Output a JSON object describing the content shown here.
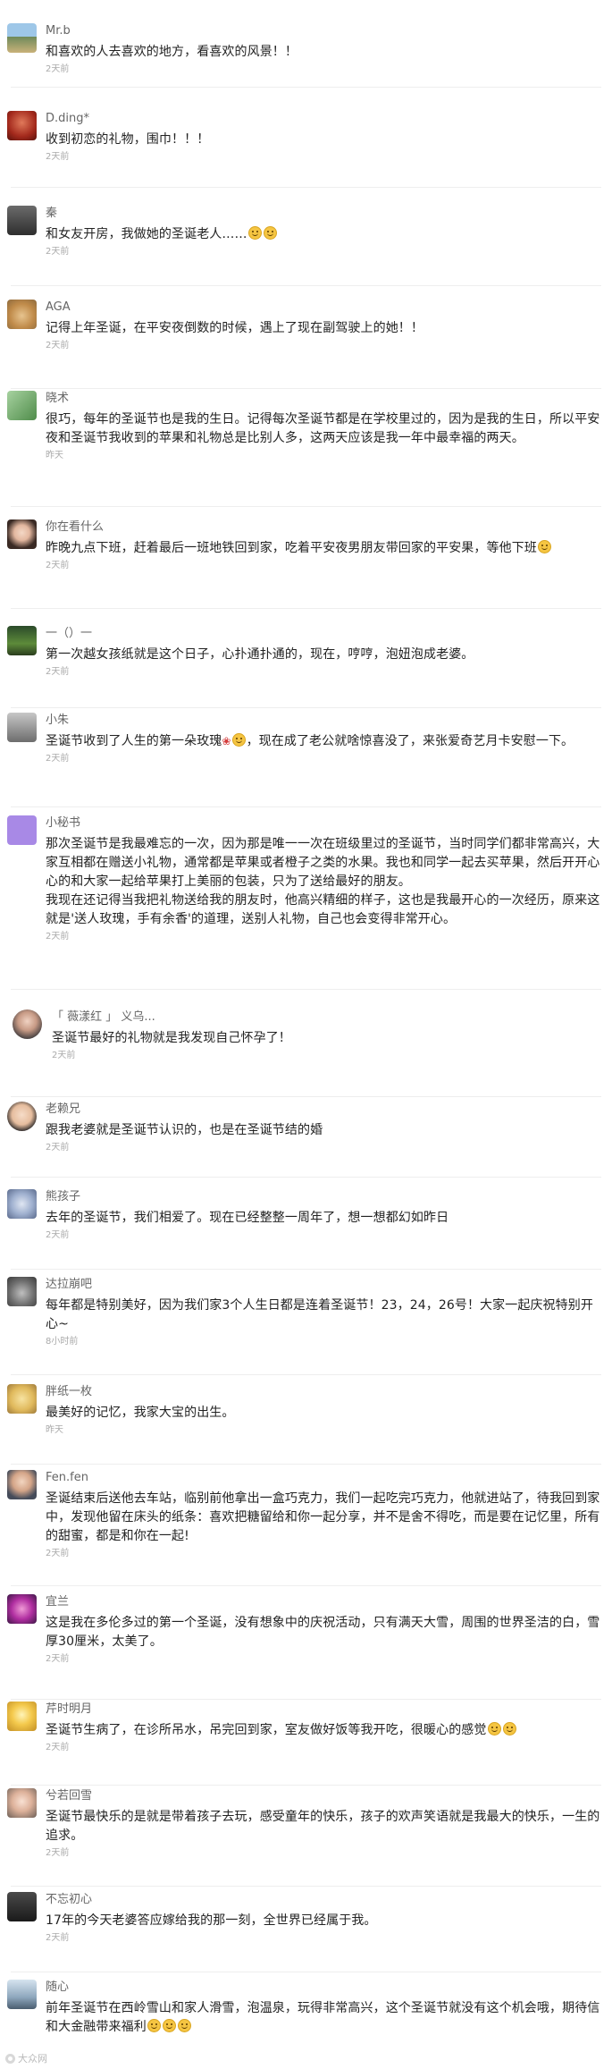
{
  "comments": [
    {
      "user": "Mr.b",
      "text": "和喜欢的人去喜欢的地方，看喜欢的风景！！",
      "time": "2天前",
      "avatar": "landscape-icon"
    },
    {
      "user": "D.ding*",
      "text": "收到初恋的礼物，围巾！！！",
      "time": "2天前",
      "avatar": "photo-icon"
    },
    {
      "user": "秦",
      "text": "和女友开房，我做她的圣诞老人……",
      "time": "2天前",
      "avatar": "person-icon",
      "emoji_count": 2
    },
    {
      "user": "AGA",
      "text": "记得上年圣诞，在平安夜倒数的时候，遇上了现在副驾驶上的她！！",
      "time": "2天前",
      "avatar": "dog-icon"
    },
    {
      "user": "晓术",
      "text": "很巧，每年的圣诞节也是我的生日。记得每次圣诞节都是在学校里过的，因为是我的生日，所以平安夜和圣诞节我收到的苹果和礼物总是比别人多，这两天应该是我一年中最幸福的两天。",
      "time": "昨天",
      "avatar": "cartoon-icon"
    },
    {
      "user": "你在看什么",
      "text": "昨晚九点下班，赶着最后一班地铁回到家，吃着平安夜男朋友带回家的平安果，等他下班",
      "time": "2天前",
      "avatar": "girl-icon",
      "emoji_count": 1
    },
    {
      "user": "一（）一",
      "text": "第一次越女孩纸就是这个日子，心扑通扑通的，现在，哼哼，泡妞泡成老婆。",
      "time": "2天前",
      "avatar": "tree-icon"
    },
    {
      "user": "小朱",
      "text_a": "圣诞节收到了人生的第一朵玫瑰",
      "text_b": "，现在成了老公就啥惊喜没了，来张爱奇艺月卡安慰一下。",
      "time": "2天前",
      "avatar": "person-icon"
    },
    {
      "user": "小秘书",
      "para1": "那次圣诞节是我最难忘的一次，因为那是唯一一次在班级里过的圣诞节，当时同学们都非常高兴，大家互相都在赠送小礼物，通常都是苹果或者橙子之类的水果。我也和同学一起去买苹果，然后开开心心的和大家一起给苹果打上美丽的包装，只为了送给最好的朋友。",
      "para2": "我现在还记得当我把礼物送给我的朋友时，他高兴精细的样子，这也是我最开心的一次经历，原来这就是'送人玫瑰，手有余香'的道理，送别人礼物，自己也会变得非常开心。",
      "time": "2天前",
      "avatar": "bag-icon"
    },
    {
      "user": "「 薇漾红 」 义乌...",
      "text": "圣诞节最好的礼物就是我发现自己怀孕了！",
      "time": "2天前",
      "avatar": "woman-icon"
    },
    {
      "user": "老赖兄",
      "text": "跟我老婆就是圣诞节认识的，也是在圣诞节结的婚",
      "time": "2天前",
      "avatar": "boy-icon"
    },
    {
      "user": "熊孩子",
      "text": "去年的圣诞节，我们相爱了。现在已经整整一周年了，想一想都幻如昨日",
      "time": "2天前",
      "avatar": "anime-icon"
    },
    {
      "user": "达拉崩吧",
      "text": "每年都是特别美好，因为我们家3个人生日都是连着圣诞节！23，24，26号！大家一起庆祝特别开心~",
      "time": "8小时前",
      "avatar": "cat-icon"
    },
    {
      "user": "胖纸一枚",
      "text": "最美好的记忆，我家大宝的出生。",
      "time": "昨天",
      "avatar": "chick-icon"
    },
    {
      "user": "Fen.fen",
      "text": "圣诞结束后送他去车站，临别前他拿出一盒巧克力，我们一起吃完巧克力，他就进站了，待我回到家中，发现他留在床头的纸条：喜欢把糖留给和你一起分享，并不是舍不得吃，而是要在记忆里，所有的甜蜜，都是和你在一起!",
      "time": "2天前",
      "avatar": "man-icon"
    },
    {
      "user": "宜兰",
      "text": "这是我在多伦多过的第一个圣诞，没有想象中的庆祝活动，只有满天大雪，周围的世界圣洁的白，雪厚30厘米，太美了。",
      "time": "2天前",
      "avatar": "flower-icon"
    },
    {
      "user": "芹时明月",
      "text": "圣诞节生病了，在诊所吊水，吊完回到家，室友做好饭等我开吃，很暖心的感觉",
      "time": "2天前",
      "avatar": "cartoon-girl-icon",
      "emoji_count": 2
    },
    {
      "user": "兮若回雪",
      "text": "圣诞节最快乐的是就是带着孩子去玩，感受童年的快乐，孩子的欢声笑语就是我最大的快乐，一生的追求。",
      "time": "2天前",
      "avatar": "child-icon"
    },
    {
      "user": "不忘初心",
      "text": "17年的今天老婆答应嫁给我的那一刻，全世界已经属于我。",
      "time": "2天前",
      "avatar": "dark-icon"
    },
    {
      "user": "随心",
      "text": "前年圣诞节在西岭雪山和家人滑雪，泡温泉，玩得非常高兴，这个圣诞节就没有这个机会哦，期待信和大金融带来福利",
      "time": "",
      "avatar": "sky-icon",
      "emoji_count": 3
    }
  ],
  "watermark": "大众网"
}
